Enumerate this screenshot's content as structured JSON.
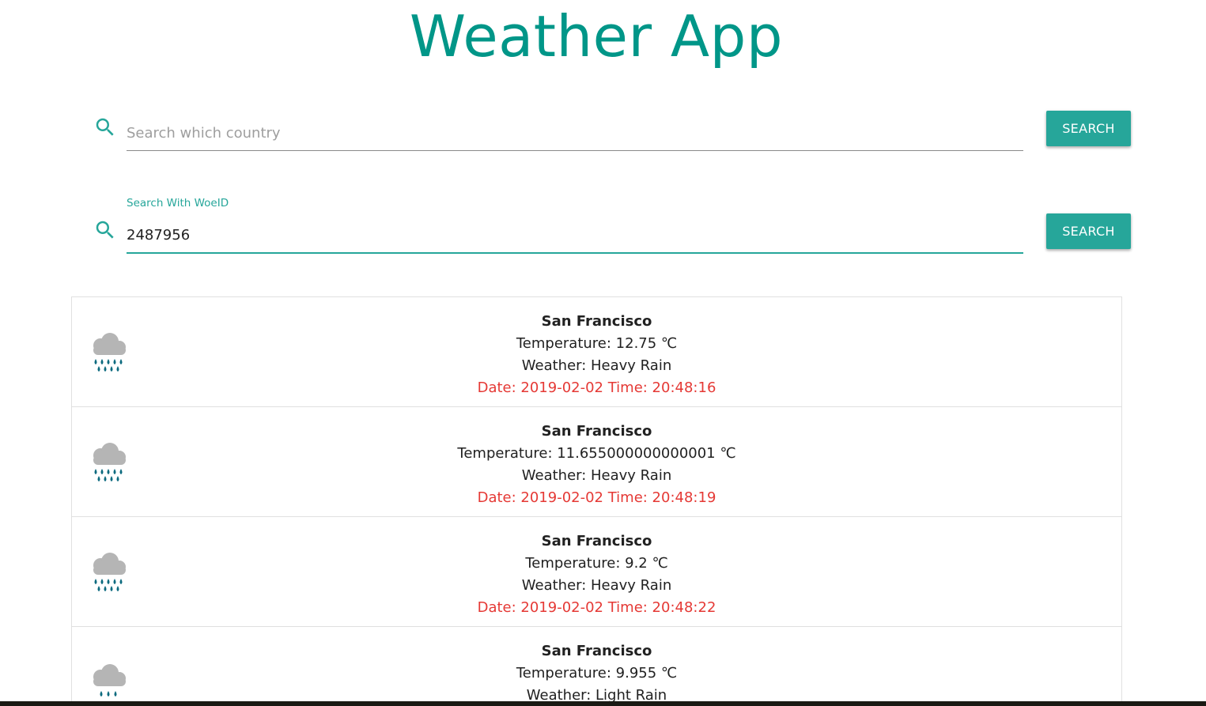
{
  "app": {
    "title": "Weather App",
    "accent_color": "#26a69a",
    "title_color": "#009688",
    "date_color": "#e53935"
  },
  "search_country": {
    "icon": "search-icon",
    "placeholder": "Search which country",
    "value": "",
    "button_label": "SEARCH"
  },
  "search_woeid": {
    "icon": "search-icon",
    "label": "Search With WoeID",
    "value": "2487956",
    "button_label": "SEARCH"
  },
  "results": [
    {
      "icon": "heavy-rain-icon",
      "city": "San Francisco",
      "temperature": "Temperature: 12.75 ℃",
      "weather": "Weather: Heavy Rain",
      "datetime": "Date: 2019-02-02 Time: 20:48:16"
    },
    {
      "icon": "heavy-rain-icon",
      "city": "San Francisco",
      "temperature": "Temperature: 11.655000000000001 ℃",
      "weather": "Weather: Heavy Rain",
      "datetime": "Date: 2019-02-02 Time: 20:48:19"
    },
    {
      "icon": "heavy-rain-icon",
      "city": "San Francisco",
      "temperature": "Temperature: 9.2 ℃",
      "weather": "Weather: Heavy Rain",
      "datetime": "Date: 2019-02-02 Time: 20:48:22"
    },
    {
      "icon": "light-rain-icon",
      "city": "San Francisco",
      "temperature": "Temperature: 9.955 ℃",
      "weather": "Weather: Light Rain",
      "datetime": ""
    }
  ]
}
